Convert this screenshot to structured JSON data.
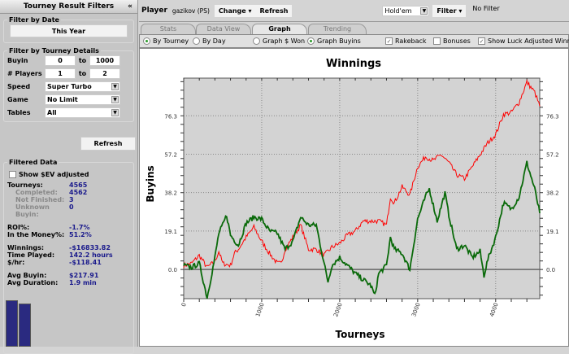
{
  "left": {
    "title": "Tourney Result Filters",
    "collapse_icon": "«",
    "date_legend": "Filter by Date",
    "date_button": "This Year",
    "details_legend": "Filter by Tourney Details",
    "buyin_label": "Buyin",
    "buyin_from": "0",
    "buyin_to": "1000",
    "to": "to",
    "players_label": "# Players",
    "players_from": "1",
    "players_to": "2",
    "speed_label": "Speed",
    "speed_value": "Super Turbo",
    "game_label": "Game",
    "game_value": "No Limit",
    "tables_label": "Tables",
    "tables_value": "All",
    "refresh": "Refresh",
    "filtered_legend": "Filtered Data",
    "ev_label": "Show $EV adjusted",
    "stats": [
      {
        "k": "Tourneys:",
        "v": "4565",
        "sub": false
      },
      {
        "k": "Completed:",
        "v": "4562",
        "sub": true
      },
      {
        "k": "Not Finished:",
        "v": "3",
        "sub": true
      },
      {
        "k": "Unknown Buyin:",
        "v": "0",
        "sub": true
      },
      {
        "k": "ROI%:",
        "v": "-1.7%",
        "sub": false
      },
      {
        "k": "In the Money%:",
        "v": "51.2%",
        "sub": false
      },
      {
        "k": "Winnings:",
        "v": "-$16833.82",
        "sub": false
      },
      {
        "k": "Time Played:",
        "v": "142.2 hours",
        "sub": false
      },
      {
        "k": "$/hr:",
        "v": "-$118.41",
        "sub": false
      },
      {
        "k": "Avg Buyin:",
        "v": "$217.91",
        "sub": false
      },
      {
        "k": "Avg Duration:",
        "v": "1.9 min",
        "sub": false
      }
    ]
  },
  "top": {
    "player_label": "Player",
    "player": "gazikov (PS)",
    "change": "Change",
    "refresh": "Refresh",
    "game": "Hold'em",
    "filter": "Filter",
    "filter_status": "No Filter"
  },
  "tabs": [
    {
      "label": "Stats"
    },
    {
      "label": "Data View"
    },
    {
      "label": "Graph",
      "active": true
    },
    {
      "label": "Trending"
    }
  ],
  "options": {
    "by_tourney": "By Tourney",
    "by_day": "By Day",
    "graph_won": "Graph $ Won",
    "graph_buyins": "Graph Buyins",
    "rakeback": "Rakeback",
    "bonuses": "Bonuses",
    "luck": "Show Luck Adjusted Winnings"
  },
  "chart_data": {
    "type": "line",
    "title": "Winnings",
    "xlabel": "Tourneys",
    "ylabel": "Buyins",
    "xlim": [
      0,
      4565
    ],
    "ylim": [
      -14.5,
      95
    ],
    "xticks": [
      "0",
      "1000",
      "2000",
      "3000",
      "4000"
    ],
    "yticks": [
      "0.0",
      "19.1",
      "38.2",
      "57.2",
      "76.3"
    ],
    "grid": true,
    "series": [
      {
        "color": "#ff0000",
        "x": [
          0,
          100,
          200,
          300,
          400,
          450,
          500,
          600,
          650,
          700,
          800,
          900,
          1000,
          1100,
          1200,
          1250,
          1300,
          1400,
          1500,
          1600,
          1700,
          1800,
          1900,
          2000,
          2100,
          2200,
          2300,
          2400,
          2500,
          2600,
          2650,
          2700,
          2800,
          2900,
          3000,
          3100,
          3200,
          3300,
          3400,
          3500,
          3600,
          3700,
          3800,
          3900,
          4000,
          4100,
          4200,
          4300,
          4400,
          4500,
          4565
        ],
        "y": [
          2,
          3,
          7,
          1,
          4,
          9,
          3,
          2,
          8,
          10,
          16,
          21,
          14,
          8,
          3,
          3,
          10,
          16,
          22,
          10,
          10,
          7,
          11,
          13,
          17,
          19,
          24,
          24,
          24,
          22,
          36,
          33,
          41,
          37,
          51,
          56,
          54,
          57,
          53,
          47,
          45,
          51,
          57,
          63,
          67,
          77,
          78,
          83,
          93,
          88,
          81
        ]
      },
      {
        "color": "#0a6a0a",
        "x": [
          0,
          100,
          200,
          300,
          400,
          450,
          500,
          550,
          600,
          700,
          800,
          900,
          1000,
          1100,
          1200,
          1300,
          1400,
          1500,
          1600,
          1700,
          1800,
          1850,
          1900,
          2000,
          2100,
          2200,
          2300,
          2400,
          2450,
          2500,
          2600,
          2650,
          2700,
          2800,
          2900,
          3000,
          3100,
          3150,
          3250,
          3350,
          3400,
          3500,
          3600,
          3700,
          3800,
          3850,
          3900,
          4000,
          4100,
          4200,
          4300,
          4400,
          4500,
          4565
        ],
        "y": [
          2,
          1,
          3,
          -14,
          6,
          18,
          22,
          27,
          17,
          12,
          23,
          26,
          25,
          19,
          18,
          10,
          14,
          26,
          22,
          22,
          3,
          -6,
          2,
          6,
          2,
          -2,
          -5,
          -8,
          -13,
          -2,
          2,
          16,
          10,
          8,
          0,
          25,
          36,
          40,
          24,
          38,
          27,
          10,
          12,
          6,
          9,
          -3,
          5,
          16,
          33,
          30,
          36,
          53,
          40,
          28
        ]
      }
    ]
  }
}
